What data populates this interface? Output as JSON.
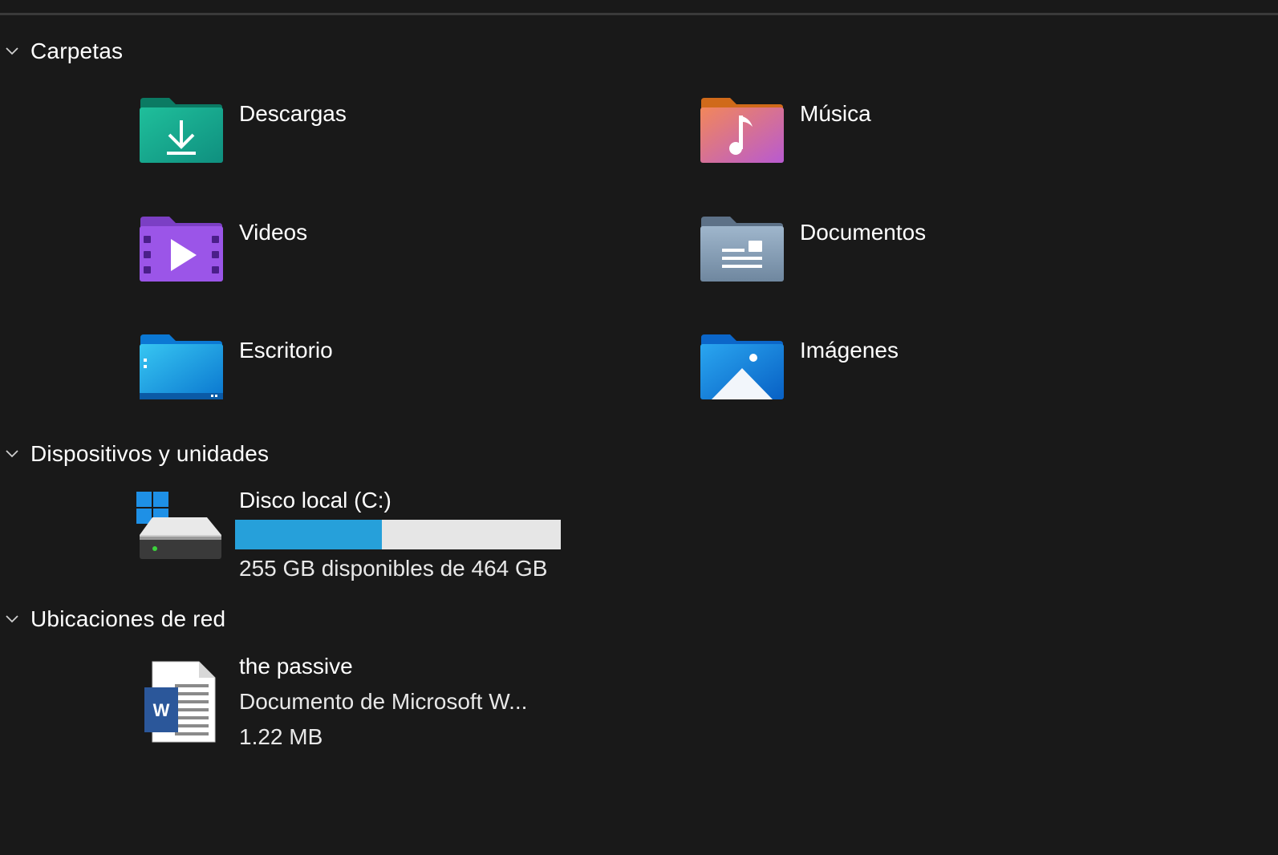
{
  "groups": {
    "folders": {
      "title": "Carpetas"
    },
    "devices": {
      "title": "Dispositivos y unidades"
    },
    "network": {
      "title": "Ubicaciones de red"
    }
  },
  "folders": [
    {
      "name": "Descargas",
      "icon": "downloads-folder-icon"
    },
    {
      "name": "Música",
      "icon": "music-folder-icon"
    },
    {
      "name": "Videos",
      "icon": "videos-folder-icon"
    },
    {
      "name": "Documentos",
      "icon": "documents-folder-icon"
    },
    {
      "name": "Escritorio",
      "icon": "desktop-folder-icon"
    },
    {
      "name": "Imágenes",
      "icon": "pictures-folder-icon"
    }
  ],
  "drive": {
    "name": "Disco local (C:)",
    "free_text": "255 GB disponibles de 464 GB",
    "used_fraction": 0.45,
    "icon": "hard-drive-icon"
  },
  "network_item": {
    "name": "the passive",
    "type": "Documento de Microsoft W...",
    "size": "1.22 MB",
    "icon": "word-document-icon"
  },
  "colors": {
    "background": "#191919",
    "bar_fill": "#26a0da",
    "bar_track": "#e6e6e6"
  }
}
